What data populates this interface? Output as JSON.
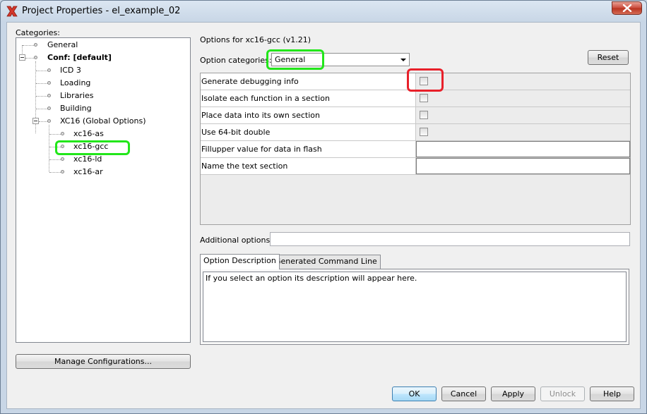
{
  "window": {
    "title": "Project Properties - el_example_02",
    "app_icon": "red-x-icon",
    "close_icon": "close-icon"
  },
  "categories": {
    "label": "Categories:",
    "tree": [
      {
        "label": "General",
        "bold": false
      },
      {
        "label": "Conf: [default]",
        "bold": true
      },
      {
        "label": "ICD 3",
        "bold": false
      },
      {
        "label": "Loading",
        "bold": false
      },
      {
        "label": "Libraries",
        "bold": false
      },
      {
        "label": "Building",
        "bold": false
      },
      {
        "label": "XC16 (Global Options)",
        "bold": false
      },
      {
        "label": "xc16-as",
        "bold": false
      },
      {
        "label": "xc16-gcc",
        "bold": false
      },
      {
        "label": "xc16-ld",
        "bold": false
      },
      {
        "label": "xc16-ar",
        "bold": false
      }
    ],
    "manage_button": "Manage Configurations..."
  },
  "options": {
    "title": "Options for xc16-gcc (v1.21)",
    "category_label": "Option categories:",
    "category_value": "General",
    "reset_button": "Reset",
    "rows": [
      {
        "name": "Generate debugging info",
        "type": "checkbox",
        "checked": false
      },
      {
        "name": "Isolate each function in a section",
        "type": "checkbox",
        "checked": false
      },
      {
        "name": "Place data into its own section",
        "type": "checkbox",
        "checked": false
      },
      {
        "name": "Use 64-bit double",
        "type": "checkbox",
        "checked": false
      },
      {
        "name": "Fillupper value for data in flash",
        "type": "text",
        "value": ""
      },
      {
        "name": "Name the text section",
        "type": "text",
        "value": ""
      }
    ],
    "additional_label": "Additional options:",
    "additional_value": ""
  },
  "tabs": {
    "items": [
      "Option Description",
      "Generated Command Line"
    ],
    "active": 0,
    "description": "If you select an option its description will appear here."
  },
  "buttons": {
    "ok": "OK",
    "cancel": "Cancel",
    "apply": "Apply",
    "unlock": "Unlock",
    "help": "Help"
  },
  "colors": {
    "highlight_green": "#22e61a",
    "highlight_red": "#e8202a"
  }
}
